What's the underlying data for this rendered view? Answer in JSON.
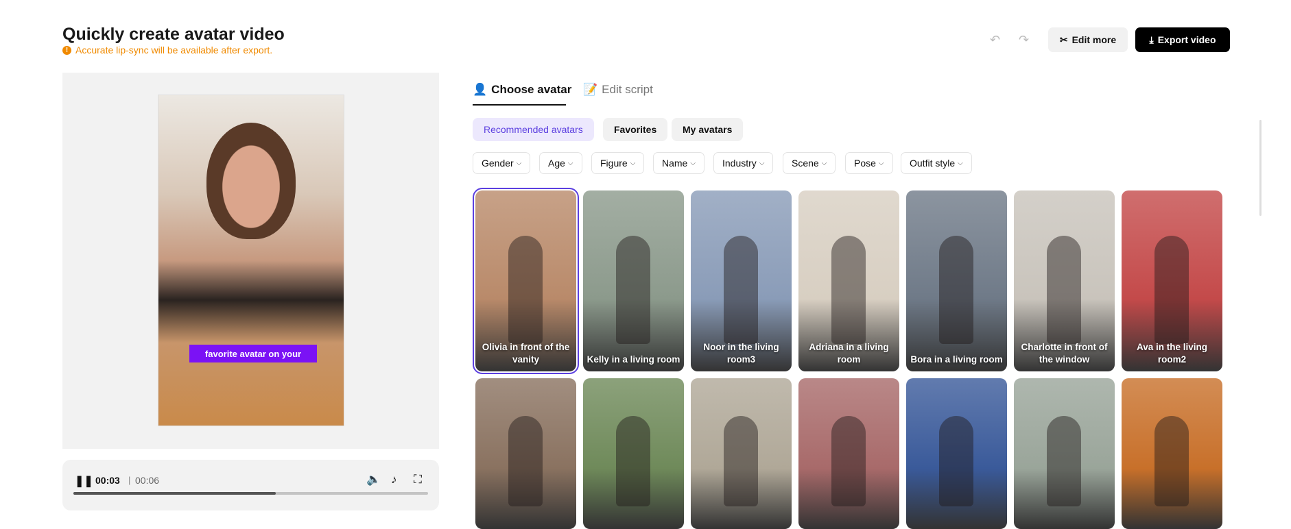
{
  "header": {
    "title": "Quickly create avatar video",
    "warning": "Accurate lip-sync will be available after export.",
    "edit_more": "Edit more",
    "export": "Export video"
  },
  "preview": {
    "caption": "favorite avatar on your",
    "current_time": "00:03",
    "separator": "|",
    "duration": "00:06",
    "progress_percent": 57
  },
  "tabs": [
    {
      "label": "Choose avatar"
    },
    {
      "label": "Edit script"
    }
  ],
  "chips": [
    {
      "label": "Recommended avatars"
    },
    {
      "label": "Favorites"
    },
    {
      "label": "My avatars"
    }
  ],
  "filters": [
    {
      "label": "Gender"
    },
    {
      "label": "Age"
    },
    {
      "label": "Figure"
    },
    {
      "label": "Name"
    },
    {
      "label": "Industry"
    },
    {
      "label": "Scene"
    },
    {
      "label": "Pose"
    },
    {
      "label": "Outfit style"
    }
  ],
  "avatars_row1": [
    {
      "label": "Olivia in front of the vanity",
      "color": "#b98a6a"
    },
    {
      "label": "Kelly in a living room",
      "color": "#8c9a8c"
    },
    {
      "label": "Noor in the living room3",
      "color": "#8a9cb8"
    },
    {
      "label": "Adriana in a living room",
      "color": "#d8cfc2"
    },
    {
      "label": "Bora in a living room",
      "color": "#6f7a88"
    },
    {
      "label": "Charlotte in front of the window",
      "color": "#c9c4bc"
    },
    {
      "label": "Ava in the living room2",
      "color": "#c44a4a"
    }
  ],
  "avatars_row2": [
    {
      "color": "#8a7260"
    },
    {
      "color": "#6f8a5a"
    },
    {
      "color": "#b0a898"
    },
    {
      "color": "#a86a6a"
    },
    {
      "color": "#3a5a9a"
    },
    {
      "color": "#9aa59a"
    },
    {
      "color": "#c8702a"
    }
  ]
}
